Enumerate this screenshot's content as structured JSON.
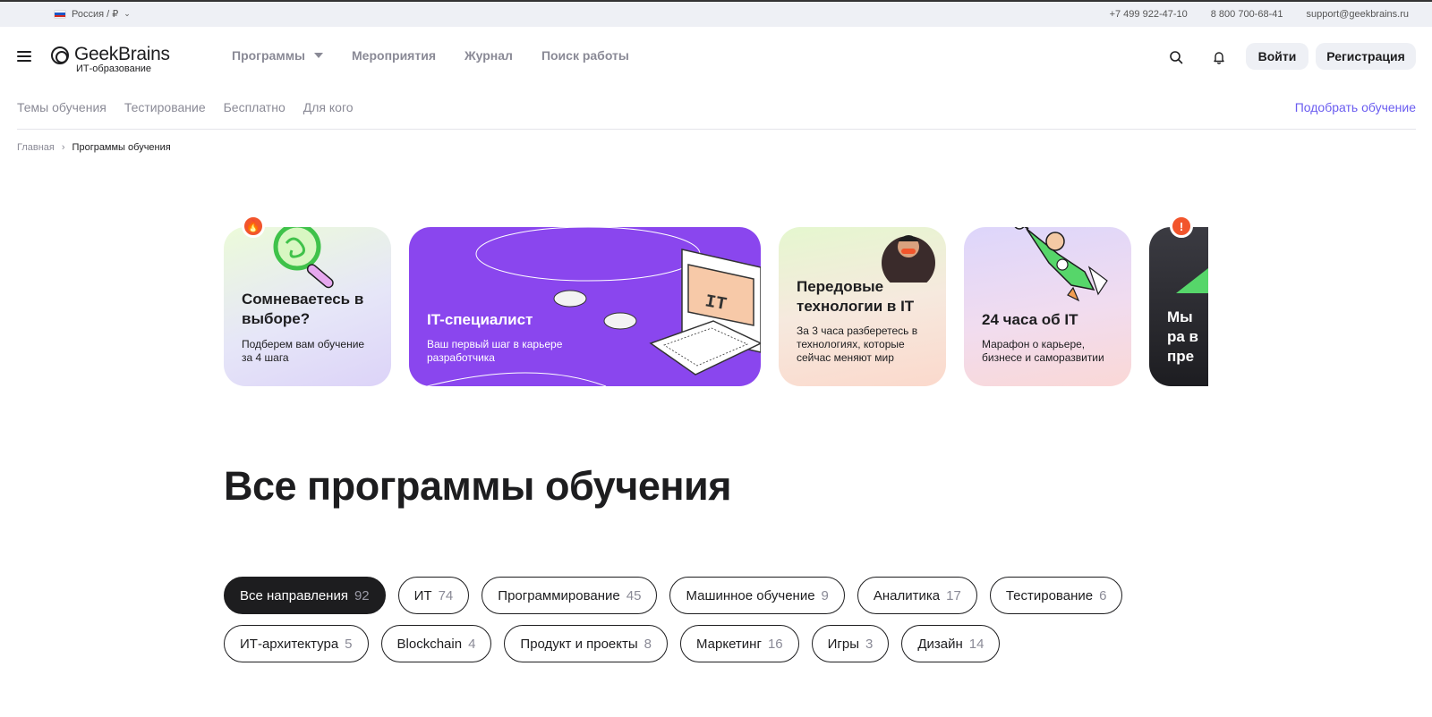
{
  "topbar": {
    "region": "Россия / ₽",
    "phone1": "+7 499 922-47-10",
    "phone2": "8 800 700-68-41",
    "email": "support@geekbrains.ru"
  },
  "header": {
    "logo_name": "GeekBrains",
    "logo_sub": "ИТ-образование",
    "nav": [
      "Программы",
      "Мероприятия",
      "Журнал",
      "Поиск работы"
    ],
    "login": "Войти",
    "register": "Регистрация"
  },
  "subnav": {
    "items": [
      "Темы обучения",
      "Тестирование",
      "Бесплатно",
      "Для кого"
    ],
    "pick": "Подобрать обучение"
  },
  "breadcrumbs": {
    "home": "Главная",
    "current": "Программы обучения"
  },
  "cards": [
    {
      "title": "Сомневаетесь в выборе?",
      "text": "Подберем вам обучение за 4 шага"
    },
    {
      "title": "IT-специалист",
      "text": "Ваш первый шаг в карьере разработчика"
    },
    {
      "title": "Передовые технологии в IT",
      "text": "За 3 часа разберетесь в технологиях, которые сейчас меняют мир"
    },
    {
      "title": "24 часа об IT",
      "text": "Марафон о карьере, бизнесе и саморазвитии"
    },
    {
      "title": "Мы ра в пре режи",
      "text": ""
    }
  ],
  "page_title": "Все программы обучения",
  "filters": {
    "row1": [
      {
        "label": "Все направления",
        "count": "92"
      },
      {
        "label": "ИТ",
        "count": "74"
      },
      {
        "label": "Программирование",
        "count": "45"
      },
      {
        "label": "Машинное обучение",
        "count": "9"
      },
      {
        "label": "Аналитика",
        "count": "17"
      },
      {
        "label": "Тестирование",
        "count": "6"
      }
    ],
    "row2": [
      {
        "label": "ИТ-архитектура",
        "count": "5"
      },
      {
        "label": "Blockchain",
        "count": "4"
      },
      {
        "label": "Продукт и проекты",
        "count": "8"
      },
      {
        "label": "Маркетинг",
        "count": "16"
      },
      {
        "label": "Игры",
        "count": "3"
      },
      {
        "label": "Дизайн",
        "count": "14"
      }
    ]
  },
  "colors": {
    "accent": "#6a5cf0",
    "purple_card": "#8a46ee",
    "badge": "#f2552c",
    "dark": "#1d1d1f"
  }
}
